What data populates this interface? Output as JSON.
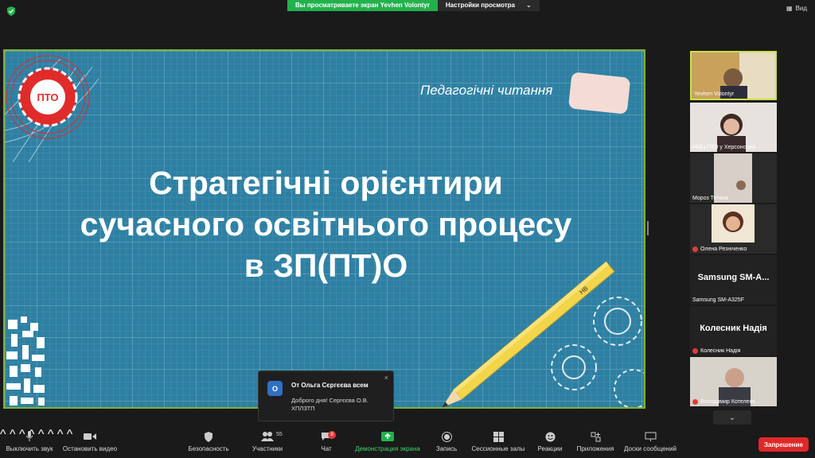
{
  "top": {
    "banner": "Вы просматриваете экран Yevhen Volontyr",
    "view_options": "Настройки просмотра",
    "view_button": "Вид"
  },
  "slide": {
    "subtitle": "Педагогічні читання",
    "title_lines": [
      "Стратегічні орієнтири",
      "сучасного освітнього процесу",
      "в ЗП(ПТ)О"
    ],
    "logo_text": "ПТО",
    "pencil_text": "HB"
  },
  "chat_popup": {
    "avatar_letter": "О",
    "from": "От Ольга Сєргєєва всем",
    "message": "Доброго дня! Сергєєва О.В. ХПЛЗТП",
    "close": "×"
  },
  "participants": [
    {
      "name": "Yevhen Volontyr",
      "muted": false,
      "active": true
    },
    {
      "name": "НМЦ ПТО у Херсонській ...",
      "muted": false,
      "active": false
    },
    {
      "name": "Мороз Тетяна",
      "muted": false,
      "active": false
    },
    {
      "name": "Олена Резніченко",
      "muted": true,
      "active": false
    },
    {
      "name": "Samsung SM-A325F",
      "big": "Samsung SM-A...",
      "muted": false,
      "active": false
    },
    {
      "name": "Колесник Надія",
      "big": "Колесник Надія",
      "muted": true,
      "active": false
    },
    {
      "name": "Володимир Котеленє...",
      "muted": true,
      "active": false
    }
  ],
  "toolbar": {
    "mute": "Выключить звук",
    "video": "Остановить видео",
    "security": "Безопасность",
    "participants": "Участники",
    "participants_count": "55",
    "chat": "Чат",
    "chat_badge": "9",
    "share": "Демонстрация экрана",
    "record": "Запись",
    "breakout": "Сессионные залы",
    "reactions": "Реакции",
    "apps": "Приложения",
    "whiteboards": "Доски сообщений",
    "end": "Запрешение"
  },
  "colors": {
    "share_green": "#22b14c",
    "end_red": "#e02828",
    "active_tile": "#cbe04a",
    "slide_bg": "#2e80a3"
  }
}
